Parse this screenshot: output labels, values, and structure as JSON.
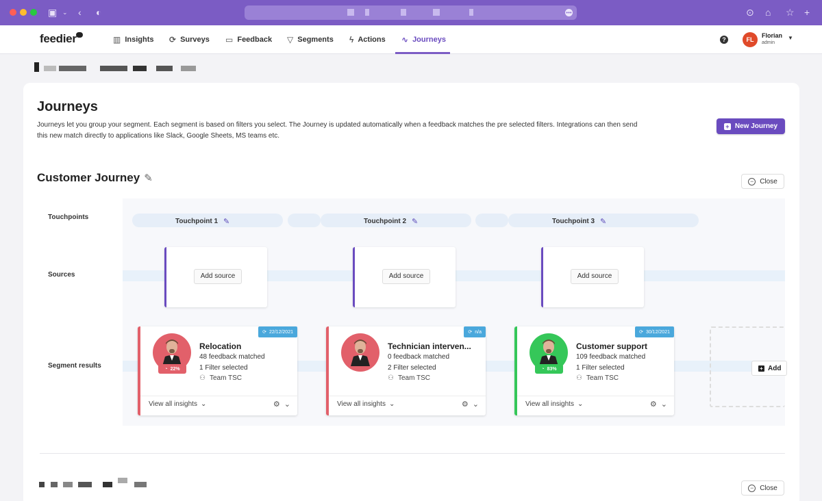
{
  "browser": {
    "sidebar_icon": "sidebar-toggle-icon",
    "back_icon": "back-arrow-icon",
    "shield_icon": "shield-icon",
    "url_dot_icon": "more-dots-icon",
    "right_icons": [
      "download-icon",
      "home-icon",
      "star-icon",
      "plus-icon"
    ]
  },
  "nav": {
    "logo": "feedier",
    "items": [
      {
        "label": "Insights",
        "icon": "bar-chart-icon"
      },
      {
        "label": "Surveys",
        "icon": "survey-icon"
      },
      {
        "label": "Feedback",
        "icon": "chat-icon"
      },
      {
        "label": "Segments",
        "icon": "filter-icon"
      },
      {
        "label": "Actions",
        "icon": "bolt-icon"
      },
      {
        "label": "Journeys",
        "icon": "pulse-icon"
      }
    ],
    "active": "Journeys",
    "help": "?",
    "user": {
      "initials": "FL",
      "name": "Florian",
      "role": "admin"
    }
  },
  "page": {
    "title": "Journeys",
    "description": "Journeys let you group your segment. Each segment is based on filters you select. The Journey is updated automatically when a feedback matches the pre selected filters. Integrations can then send this new match directly to applications like Slack, Google Sheets, MS teams etc.",
    "new_button": "New Journey"
  },
  "journey": {
    "title": "Customer Journey",
    "close_label": "Close",
    "row_labels": {
      "touchpoints": "Touchpoints",
      "sources": "Sources",
      "segments": "Segment results"
    },
    "touchpoints": [
      "Touchpoint 1",
      "Touchpoint 2",
      "Touchpoint 3"
    ],
    "add_source_label": "Add source",
    "add_segment_label": "Add",
    "segments": [
      {
        "name": "Relocation",
        "date": "22/12/2021",
        "score": "22%",
        "matched": "48 feedback matched",
        "filters": "1 Filter selected",
        "team": "Team TSC",
        "accent": "#e2606a",
        "score_color": "#e2606a"
      },
      {
        "name": "Technician interven...",
        "date": "n/a",
        "score": "",
        "matched": "0 feedback matched",
        "filters": "2 Filter selected",
        "team": "Team TSC",
        "accent": "#e2606a",
        "score_color": ""
      },
      {
        "name": "Customer support",
        "date": "30/12/2021",
        "score": "83%",
        "matched": "109 feedback matched",
        "filters": "1 Filter selected",
        "team": "Team TSC",
        "accent": "#35c759",
        "score_color": "#35c759"
      }
    ],
    "view_all_label": "View all insights"
  },
  "second_journey": {
    "close_label": "Close"
  },
  "colors": {
    "brand": "#6a4bbf",
    "chrome": "#7b5cc4",
    "badge": "#4aa8dc"
  }
}
